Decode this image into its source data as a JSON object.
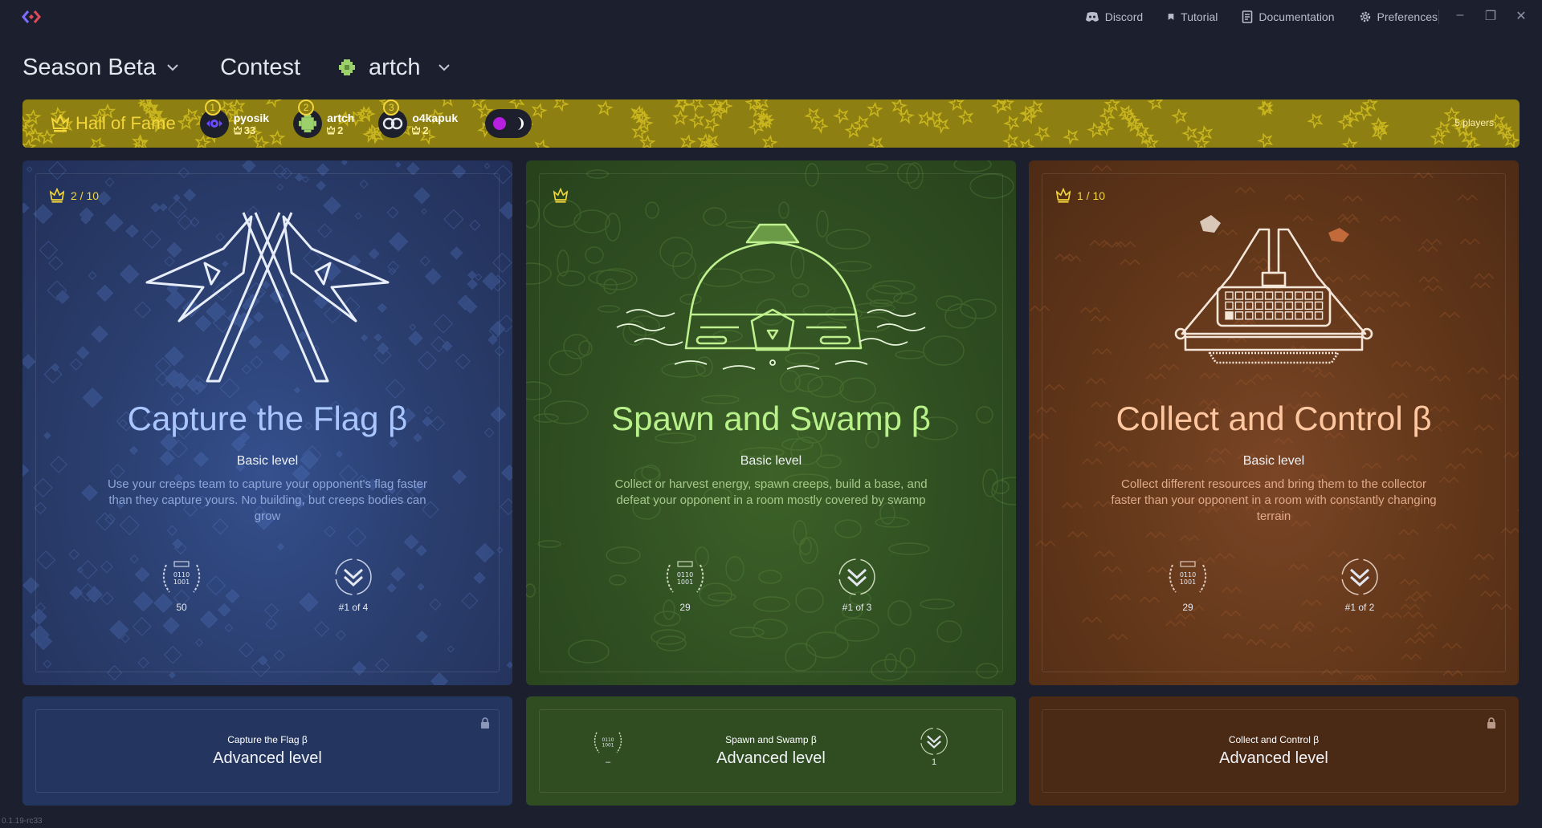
{
  "window": {
    "nav": [
      {
        "label": "Discord",
        "icon": "discord-icon"
      },
      {
        "label": "Tutorial",
        "icon": "bookmark-icon"
      },
      {
        "label": "Documentation",
        "icon": "document-icon"
      },
      {
        "label": "Preferences",
        "icon": "gear-icon"
      }
    ],
    "controls": [
      "minimize",
      "restore",
      "close"
    ]
  },
  "header": {
    "season": "Season Beta",
    "mode": "Contest",
    "user": "artch"
  },
  "hall_of_fame": {
    "title": "Hall of Fame",
    "players": [
      {
        "rank": "1",
        "name": "pyosik",
        "score": "33"
      },
      {
        "rank": "2",
        "name": "artch",
        "score": "2"
      },
      {
        "rank": "3",
        "name": "o4kapuk",
        "score": "2"
      }
    ],
    "count": "5 players",
    "accent": "#f3d63b"
  },
  "cards": [
    {
      "theme": "blue",
      "badge": "2 / 10",
      "title": "Capture the Flag β",
      "level": "Basic level",
      "description": "Use your creeps team to capture your opponent's flag faster than they capture yours. No building, but creeps bodies can grow",
      "stat_code": "50",
      "stat_rank": "#1 of 4",
      "advanced_sub": "Capture the Flag β",
      "advanced_title": "Advanced level"
    },
    {
      "theme": "green",
      "badge": "",
      "title": "Spawn and Swamp β",
      "level": "Basic level",
      "description": "Collect or harvest energy, spawn creeps, build a base, and defeat your opponent in a room mostly covered by swamp",
      "stat_code": "29",
      "stat_rank": "#1 of 3",
      "advanced_sub": "Spawn and Swamp β",
      "advanced_title": "Advanced level",
      "advanced_code": "–",
      "advanced_rank": "1"
    },
    {
      "theme": "brown",
      "badge": "1 / 10",
      "title": "Collect and Control β",
      "level": "Basic level",
      "description": "Collect different resources and bring them to the collector faster than your opponent in a room with constantly changing terrain",
      "stat_code": "29",
      "stat_rank": "#1 of 2",
      "advanced_sub": "Collect and Control β",
      "advanced_title": "Advanced level"
    }
  ],
  "code_icon_text": [
    "0110",
    "1001"
  ],
  "version": "0.1.19-rc33"
}
